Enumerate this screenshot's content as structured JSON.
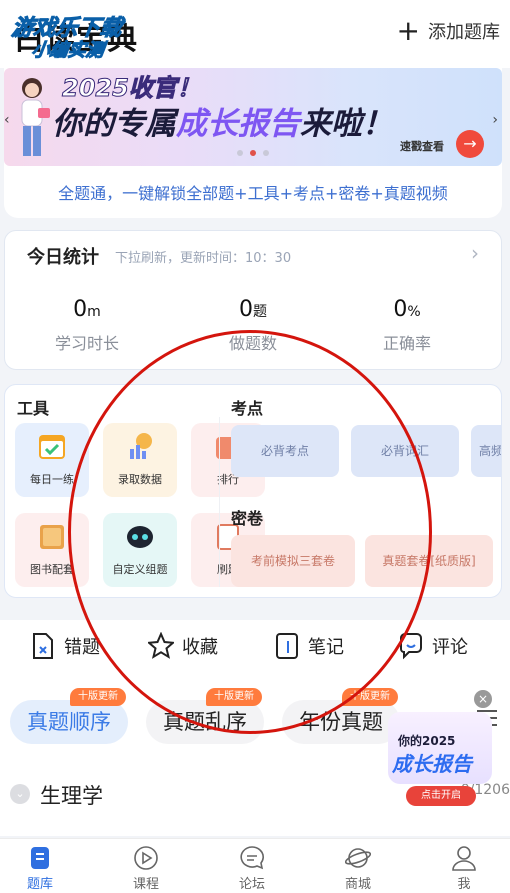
{
  "header": {
    "title": "白读宝典",
    "watermark_line1": "游戏乐下载",
    "watermark_line2": "小编实测",
    "add_bank_label": "添加题库"
  },
  "banner": {
    "line1": "2025收官！",
    "line2_prefix": "你的专属",
    "line2_accent": "成长报告",
    "line2_suffix": "来啦！",
    "cta": "速戳查看",
    "page_count": 3,
    "active_index": 1
  },
  "promo_text": "全题通，一键解锁全部题+工具+考点+密卷+真题视频",
  "stats": {
    "title": "今日统计",
    "subtitle": "下拉刷新，更新时间：10：30",
    "items": [
      {
        "value": "0",
        "unit": "m",
        "label": "学习时长"
      },
      {
        "value": "0",
        "unit": "题",
        "label": "做题数"
      },
      {
        "value": "0",
        "unit": "%",
        "label": "正确率"
      }
    ]
  },
  "tools": {
    "title": "工具",
    "items": [
      {
        "label": "每日一练",
        "icon": "calendar-icon",
        "bg": "#e6effd"
      },
      {
        "label": "录取数据",
        "icon": "chart-icon",
        "bg": "#fdf3e2"
      },
      {
        "label": "排行",
        "icon": "ranking-icon",
        "bg": "#fdeeee"
      },
      {
        "label": "图书配套",
        "icon": "book-icon",
        "bg": "#fdeeee"
      },
      {
        "label": "自定义组题",
        "icon": "robot-icon",
        "bg": "#e5f7f6"
      },
      {
        "label": "刷题",
        "icon": "notebook-icon",
        "bg": "#fdeeee"
      }
    ]
  },
  "points": {
    "title": "考点",
    "items": [
      "必背考点",
      "必背词汇",
      "高频"
    ]
  },
  "papers": {
    "title": "密卷",
    "items": [
      "考前模拟三套卷",
      "真题套卷[纸质版]"
    ]
  },
  "actions": [
    {
      "label": "错题",
      "icon": "wrong-question-icon"
    },
    {
      "label": "收藏",
      "icon": "star-icon"
    },
    {
      "label": "笔记",
      "icon": "notes-icon"
    },
    {
      "label": "评论",
      "icon": "comment-icon"
    }
  ],
  "sort_tabs": [
    {
      "label": "真题顺序",
      "badge": "十版更新",
      "active": true
    },
    {
      "label": "真题乱序",
      "badge": "十版更新",
      "active": false
    },
    {
      "label": "年份真题",
      "badge": "十版更新",
      "active": false
    }
  ],
  "subject": {
    "name": "生理学",
    "progress": "0/1206"
  },
  "float_promo": {
    "line1": "你的2025",
    "line2": "成长报告",
    "button": "点击开启"
  },
  "bottom_nav": [
    {
      "label": "题库",
      "icon": "question-bank-icon",
      "active": true
    },
    {
      "label": "课程",
      "icon": "play-circle-icon",
      "active": false
    },
    {
      "label": "论坛",
      "icon": "chat-bubble-icon",
      "active": false
    },
    {
      "label": "商城",
      "icon": "planet-icon",
      "active": false
    },
    {
      "label": "我",
      "icon": "user-icon",
      "active": false
    }
  ],
  "colors": {
    "accent": "#2f6fe0",
    "badge": "#ff7b3d",
    "annotation": "#d4150d"
  }
}
